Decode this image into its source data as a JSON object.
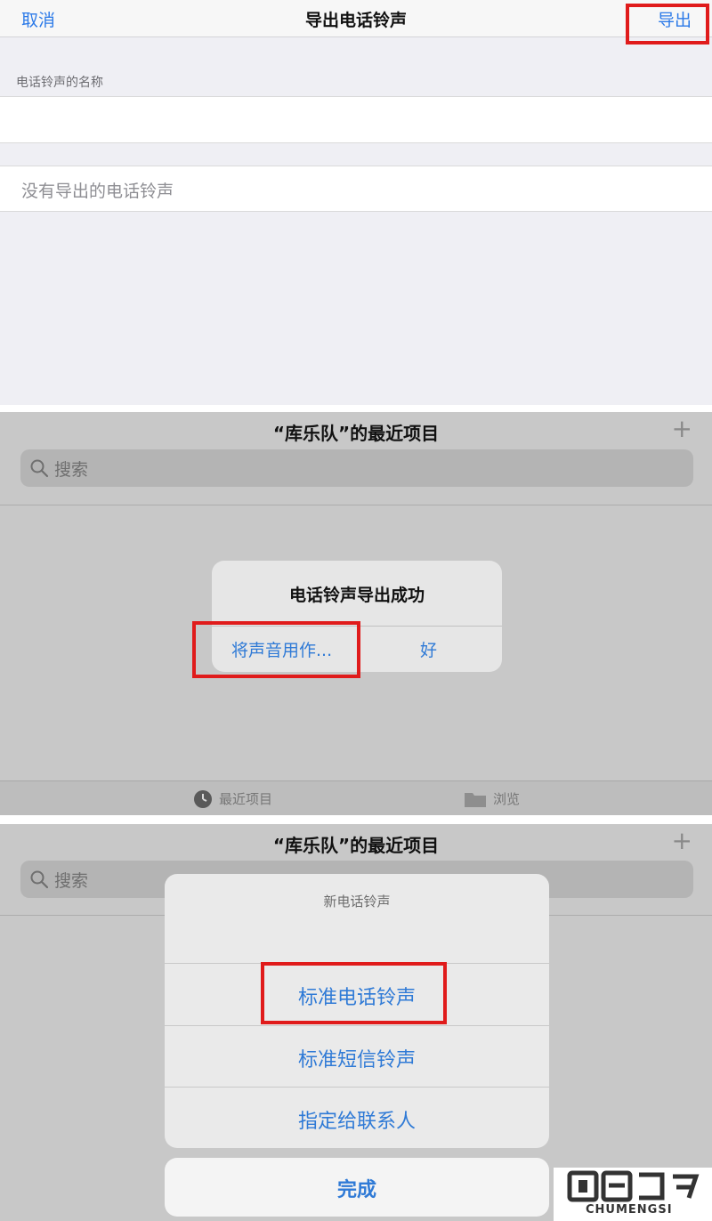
{
  "export_screen": {
    "cancel": "取消",
    "title": "导出电话铃声",
    "export": "导出",
    "name_section_header": "电话铃声的名称",
    "name_value": "",
    "no_exports": "没有导出的电话铃声"
  },
  "recents_screen": {
    "title": "“库乐队”的最近项目",
    "add_icon": "plus-icon",
    "search_placeholder": "搜索",
    "alert": {
      "title": "电话铃声导出成功",
      "use_sound_as": "将声音用作...",
      "ok": "好"
    },
    "tabs": [
      {
        "label": "最近项目",
        "icon": "clock-icon"
      },
      {
        "label": "浏览",
        "icon": "folder-icon"
      }
    ]
  },
  "ringtone_sheet": {
    "title": "“库乐队”的最近项目",
    "search_placeholder": "搜索",
    "sheet_title": "新电话铃声",
    "options": [
      "标准电话铃声",
      "标准短信铃声",
      "指定给联系人"
    ],
    "done": "完成"
  },
  "watermark": {
    "text": "CHUMENGSI"
  },
  "colors": {
    "accent": "#2f7ad6",
    "highlight": "#e01b1b"
  }
}
